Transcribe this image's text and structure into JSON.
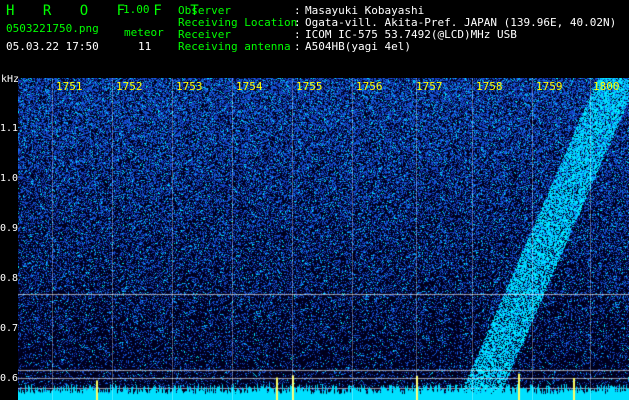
{
  "header": {
    "logo": "H R O F F T",
    "version": "1.00",
    "filename": "0503221750.png",
    "datetime": "05.03.22 17:50",
    "meteor_label": "meteor",
    "meteor_count": "11"
  },
  "info": [
    {
      "label": "Observer",
      "value": "Masayuki Kobayashi"
    },
    {
      "label": "Receiving Location",
      "value": "Ogata-vill. Akita-Pref. JAPAN (139.96E, 40.02N)"
    },
    {
      "label": "Receiver",
      "value": "ICOM IC-575 53.7492(@LCD)MHz USB"
    },
    {
      "label": "Receiving antenna",
      "value": "A504HB(yagi 4el)"
    }
  ],
  "plot": {
    "unit_label": "kHz",
    "y_ticks": [
      "1.1",
      "1.0",
      "0.9",
      "0.8",
      "0.7",
      "0.6"
    ],
    "x_ticks": [
      "1751",
      "1752",
      "1753",
      "1754",
      "1755",
      "1756",
      "1757",
      "1758",
      "1759",
      "1800"
    ]
  },
  "colors": {
    "background": "#000000",
    "label_green": "#00ff00",
    "tick_yellow": "#ffff00",
    "noise_blue": "#1e3cff",
    "signal_cyan": "#00e0ff",
    "meteor_yellow": "#ffff66"
  }
}
